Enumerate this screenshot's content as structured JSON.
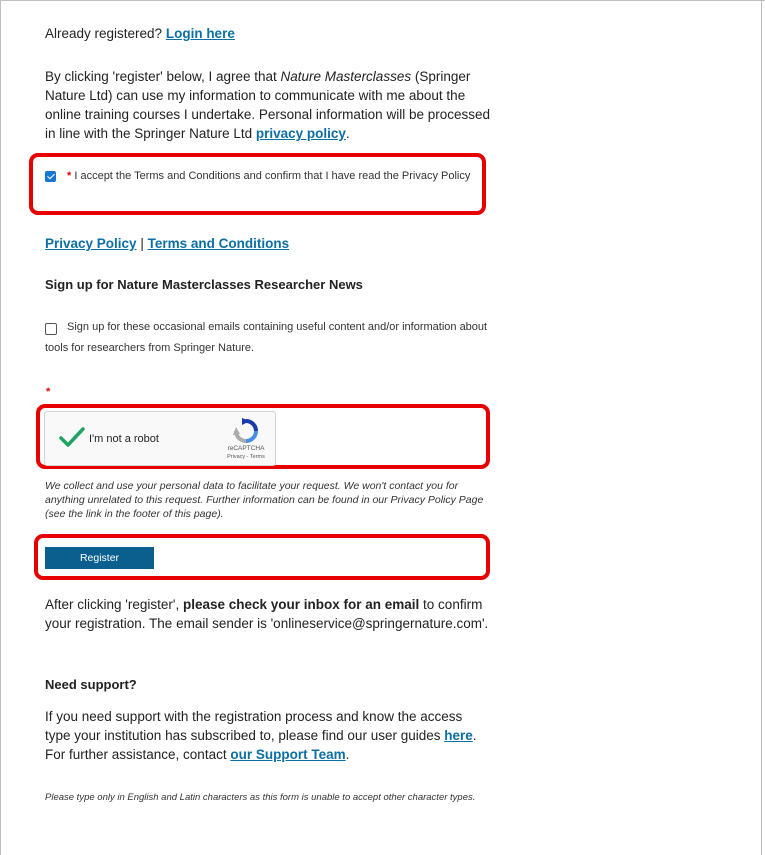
{
  "login": {
    "prefix": "Already registered? ",
    "link_text": "Login here"
  },
  "consent": {
    "part1": "By clicking 'register' below, I agree that ",
    "brand": "Nature Masterclasses",
    "part2": " (Springer Nature Ltd) can use my information to communicate with me about the online training courses I undertake. Personal information will be processed in line with the Springer Nature Ltd ",
    "link_text": "privacy policy",
    "part3": "."
  },
  "terms": {
    "required_mark": "*",
    "label": "I accept the Terms and Conditions and confirm that I have read the Privacy Policy",
    "checked": true
  },
  "links": {
    "privacy": "Privacy Policy",
    "separator": " | ",
    "terms": "Terms and Conditions"
  },
  "newsletter": {
    "heading": "Sign up for Nature Masterclasses Researcher News",
    "label": "Sign up for these occasional emails containing useful content and/or information about tools for researchers from Springer Nature.",
    "checked": false
  },
  "captcha": {
    "required_mark": "*",
    "label": "I'm not a robot",
    "brand": "reCAPTCHA",
    "privacy": "Privacy",
    "sep": " - ",
    "terms": "Terms"
  },
  "data_notice": "We collect and use your personal data to facilitate your request. We won't contact you for anything unrelated to this request. Further information can be found in our Privacy Policy Page (see the link in the footer of this page).",
  "register_button": "Register",
  "after": {
    "part1": "After clicking 'register', ",
    "bold": "please check your inbox for an email",
    "part2": " to confirm your registration. The email sender is 'onlineservice@springernature.com'."
  },
  "support": {
    "heading": "Need support?",
    "part1": "If you need support with the registration process and know the access type your institution has subscribed to, please find our user guides ",
    "link1": "here",
    "part2": ". For further assistance, contact ",
    "link2": "our Support Team",
    "part3": "."
  },
  "footer_note": "Please type only in English and Latin characters as this form is unable to accept other character types.",
  "colors": {
    "link": "#0b6fa4",
    "highlight": "#e60000",
    "button": "#0b5f8e",
    "checkbox": "#1976d2"
  }
}
